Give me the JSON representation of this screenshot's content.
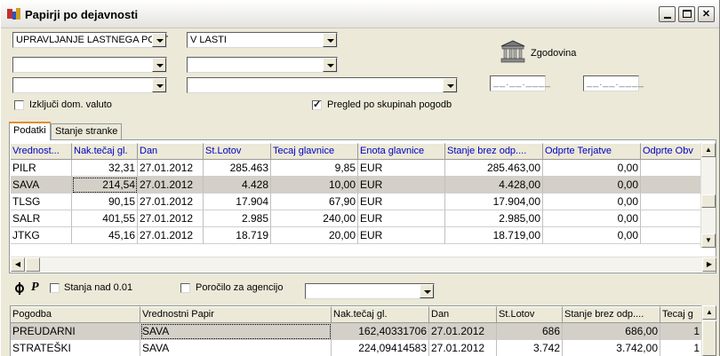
{
  "window": {
    "title": "Papirji po dejavnosti",
    "controls": {
      "minimize": "0",
      "maximize": "□",
      "close": "✕"
    }
  },
  "filters": {
    "combo1": "UPRAVLJANJE LASTNEGA PORT",
    "combo2": "V LASTI",
    "combo3": "",
    "combo4": "",
    "combo5": "",
    "combo6": "",
    "date_from": "__.__.____",
    "date_to": "__.__.____",
    "history_label": "Zgodovina",
    "exclude_domestic_label": "Izključi dom. valuto",
    "exclude_domestic_checked": false,
    "group_overview_label": "Pregled po skupinah pogodb",
    "group_overview_checked": true
  },
  "tabs": [
    {
      "label": "Podatki",
      "active": true
    },
    {
      "label": "Stanje stranke",
      "active": false
    }
  ],
  "grid1": {
    "columns": [
      "Vrednost...",
      "Nak.tečaj gl.",
      "Dan",
      "St.Lotov",
      "Tecaj glavnice",
      "Enota glavnice",
      "Stanje brez odp....",
      "Odprte Terjatve",
      "Odprte Obv"
    ],
    "rows": [
      [
        "PILR",
        "32,31",
        "27.01.2012",
        "285.463",
        "9,85",
        "EUR",
        "285.463,00",
        "0,00",
        ""
      ],
      [
        "SAVA",
        "214,54",
        "27.01.2012",
        "4.428",
        "10,00",
        "EUR",
        "4.428,00",
        "0,00",
        ""
      ],
      [
        "TLSG",
        "90,15",
        "27.01.2012",
        "17.904",
        "67,90",
        "EUR",
        "17.904,00",
        "0,00",
        ""
      ],
      [
        "SALR",
        "401,55",
        "27.01.2012",
        "2.985",
        "240,00",
        "EUR",
        "2.985,00",
        "0,00",
        ""
      ],
      [
        "JTKG",
        "45,16",
        "27.01.2012",
        "18.719",
        "20,00",
        "EUR",
        "18.719,00",
        "0,00",
        ""
      ]
    ],
    "selected_row": 1
  },
  "toolbar2": {
    "stanja_label": "Stanja nad 0.01",
    "stanja_checked": false,
    "porocilo_label": "Poročilo za agencijo",
    "porocilo_checked": false,
    "combo": ""
  },
  "grid2": {
    "columns": [
      "Pogodba",
      "Vrednostni Papir",
      "Nak.tečaj gl.",
      "Dan",
      "St.Lotov",
      "Stanje brez odp....",
      "Tecaj g"
    ],
    "rows": [
      [
        "PREUDARNI",
        "SAVA",
        "162,40331706",
        "27.01.2012",
        "686",
        "686,00",
        "1"
      ],
      [
        "STRATEŠKI",
        "SAVA",
        "224,09414583",
        "27.01.2012",
        "3.742",
        "3.742,00",
        "1"
      ]
    ],
    "selected_row": 0
  }
}
